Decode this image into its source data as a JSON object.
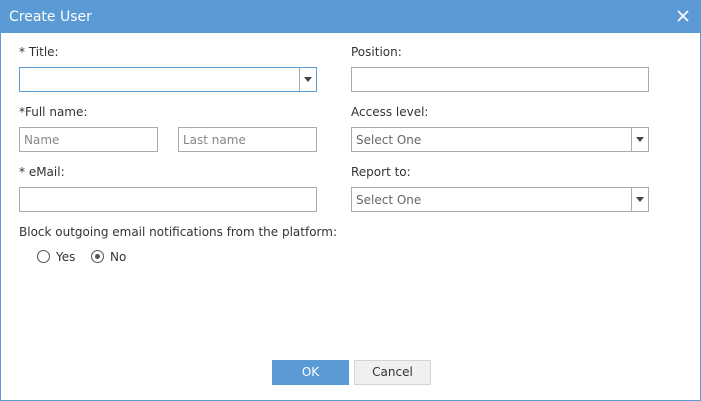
{
  "dialog": {
    "title": "Create User",
    "close_icon": "close-icon"
  },
  "form": {
    "title_label": "* Title:",
    "title_value": "",
    "full_name_label": "*Full name:",
    "first_name_placeholder": "Name",
    "last_name_placeholder": "Last name",
    "email_label": "* eMail:",
    "email_value": "",
    "position_label": "Position:",
    "position_value": "",
    "access_level_label": "Access level:",
    "access_level_value": "Select One",
    "report_to_label": "Report to:",
    "report_to_value": "Select One",
    "block_label": "Block outgoing email notifications from the platform:",
    "block_options": [
      {
        "label": "Yes",
        "checked": false
      },
      {
        "label": "No",
        "checked": true
      }
    ]
  },
  "buttons": {
    "ok_label": "OK",
    "cancel_label": "Cancel"
  },
  "colors": {
    "accent": "#5b9bd5"
  }
}
